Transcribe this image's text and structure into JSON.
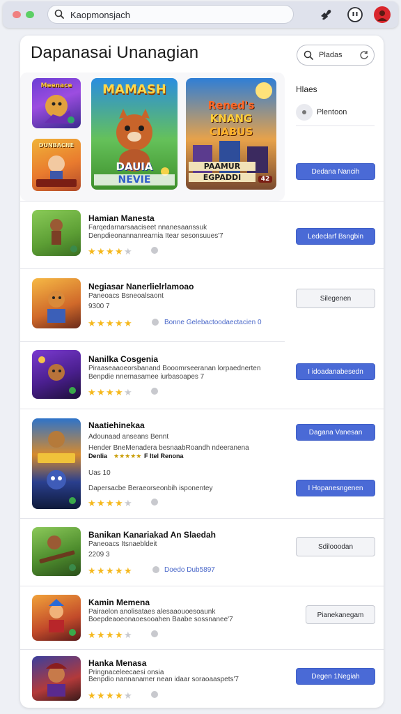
{
  "topbar": {
    "url_text": "Kaopmonsjach",
    "icons": [
      "window-close-dot",
      "window-maximize-dot",
      "search-icon",
      "extensions-icon",
      "face-icon",
      "profile-avatar"
    ]
  },
  "header": {
    "title": "Dapanasai Unanagian",
    "search_pill_label": "Pladas"
  },
  "featured": {
    "small_banners": [
      {
        "title": "Meenace"
      },
      {
        "title": "DUNBACNE"
      }
    ],
    "center_banner": {
      "title": "MAMASH",
      "bottom_line_1": "DAUIA",
      "bottom_line_2": "NEVIE"
    },
    "right_banner": {
      "title_line_1": "Rened's",
      "title_line_2": "KNANG",
      "title_line_3": "CIABUS",
      "bottom_line_1": "PAAMUR",
      "bottom_line_2": "EGPADDI",
      "badge": "42"
    }
  },
  "side_panel": {
    "heading": "Hlaes",
    "item_label": "Plentoon",
    "primary_button": "Dedana Nancih"
  },
  "rows": [
    {
      "title": "Hamian Manesta",
      "desc_lines": [
        "Farqedarnarsaaciseet nnanesaanssuk",
        "Denpdieonannanrearnia Itear sesonsuues'7"
      ],
      "rating": 3.5,
      "button": "Ledeclarf Bsngbin",
      "button_style": "blue"
    },
    {
      "title": "Negiasar Nanerlielrlamoao",
      "desc_lines": [
        "Paneoacs Bsneoalsaont",
        "9300 7"
      ],
      "rating": 5,
      "tag": "Bonne Gelebactoodaectacien 0",
      "button": "Silegenen",
      "button_style": "ghost"
    },
    {
      "title": "Nanilka Cosgenia",
      "desc_lines": [
        "Piraaseaaoeorsbanand Booomrseeranan lorpaednerten",
        "Benpdie nnernasamee iurbasoapes 7"
      ],
      "rating": 3.5,
      "button": "I idoadanabesedn",
      "button_style": "blue"
    },
    {
      "title": "Naatiehinekaa",
      "desc_lines": [
        "Adounaad anseans Bennt",
        "Hender BneMenadera besnaabRoandh ndeeranena",
        "Uas 10",
        "Dapersacbe Beraeorseonbih isponentey"
      ],
      "badge_line_1": "Denlia",
      "badge_line_2": "F Itel Renona",
      "rating": 3.5,
      "button": "Dagana Vanesan",
      "button_style": "blue",
      "button_2": "I Hopanesngenen",
      "button_2_style": "blue"
    },
    {
      "title": "Banikan Kanariakad An Slaedah",
      "desc_lines": [
        "Paneoacs Itsnaebldeit",
        "2209 3"
      ],
      "rating": 5,
      "tag": "Doedo Dub5897",
      "button": "Sdilooodan",
      "button_style": "ghost"
    },
    {
      "title": "Kamin Memena",
      "desc_lines": [
        "Pairaelon anolisataes alesaaouoesoaunk",
        "Boepdeaoeonaoesooahen Baabe sossnanee'7"
      ],
      "rating": 4,
      "button": "Pianekanegam",
      "button_style": "ghost"
    },
    {
      "title": "Hanka Menasa",
      "desc_lines": [
        "Pringnaceleecaesi onsia",
        "Benpdio nannanamer nean idaar soraoaaspets'7"
      ],
      "rating": 3.5,
      "button": "Degen 1Negiah",
      "button_style": "blue"
    }
  ],
  "colors": {
    "accent": "#4a6ad6",
    "star": "#f5b81c",
    "topbar": "#dfe2ec",
    "background": "#eef0f5"
  }
}
